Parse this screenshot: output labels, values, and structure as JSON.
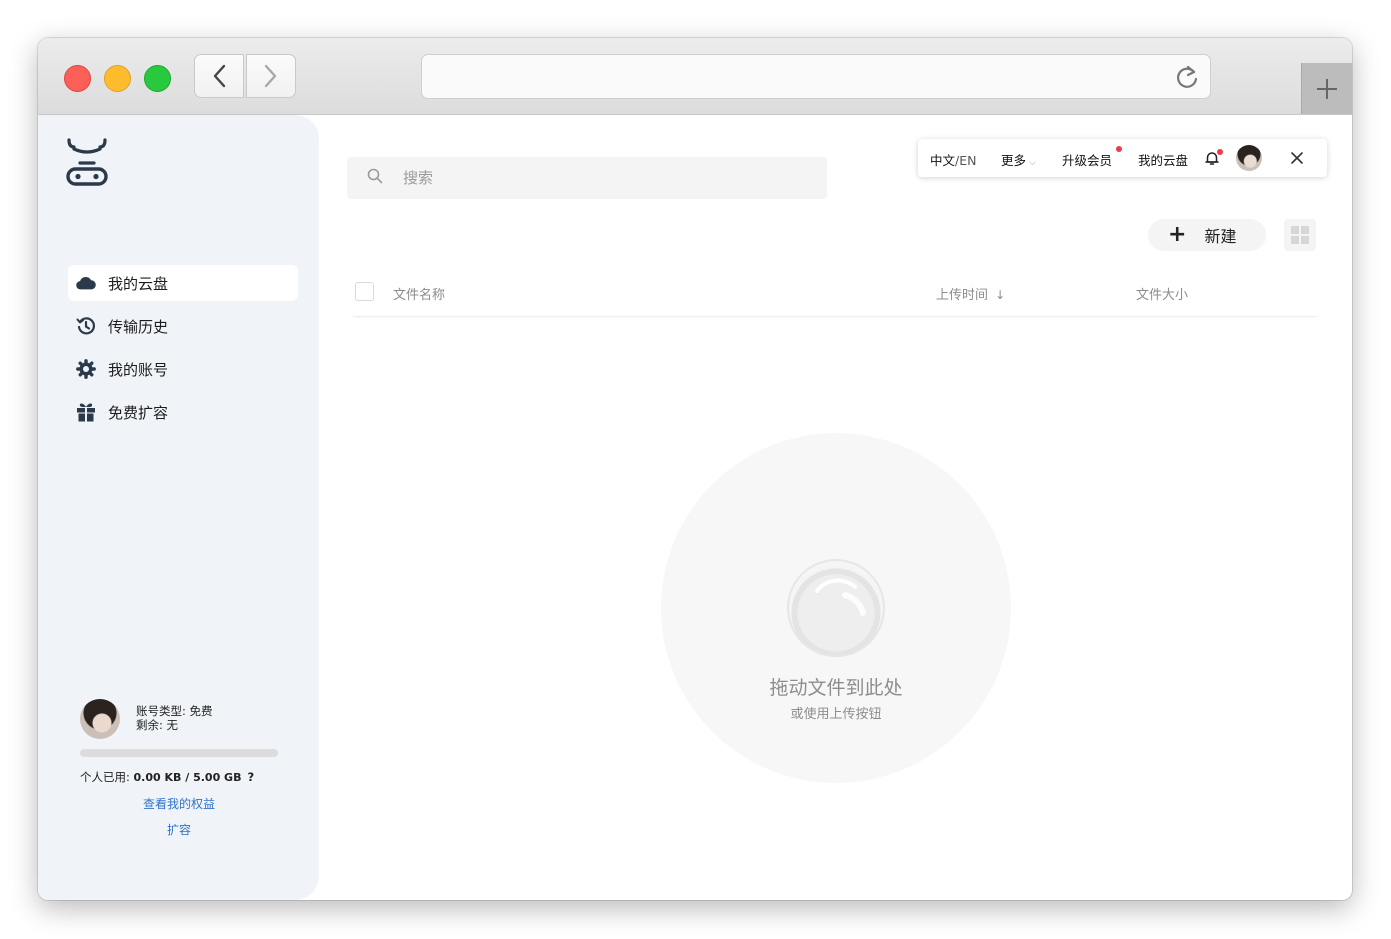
{
  "sidebar": {
    "items": [
      {
        "label": "我的云盘",
        "icon": "cloud-icon"
      },
      {
        "label": "传输历史",
        "icon": "history-icon"
      },
      {
        "label": "我的账号",
        "icon": "gear-icon"
      },
      {
        "label": "免费扩容",
        "icon": "gift-icon"
      }
    ],
    "account": {
      "type_line": "账号类型: 免费",
      "remaining_line": "剩余: 无",
      "usage_label": "个人已用: ",
      "usage_value": "0.00 KB / 5.00 GB",
      "help": "?",
      "benefits_link": "查看我的权益",
      "expand_link": "扩容",
      "usage_fraction": 0
    }
  },
  "search": {
    "placeholder": "搜索",
    "value": ""
  },
  "topmenu": {
    "lang_zh": "中文",
    "lang_en": "/EN",
    "more": "更多",
    "upgrade": "升级会员",
    "my_cloud": "我的云盘"
  },
  "toolbar": {
    "new_label": "新建"
  },
  "table": {
    "columns": [
      "文件名称",
      "上传时间",
      "文件大小"
    ],
    "sort_indicator": "↓"
  },
  "dropzone": {
    "title": "拖动文件到此处",
    "subtitle": "或使用上传按钮"
  },
  "colors": {
    "sidebar_bg": "#f0f4f8",
    "notification_dot": "#f2394b",
    "link": "#2f73c9"
  }
}
